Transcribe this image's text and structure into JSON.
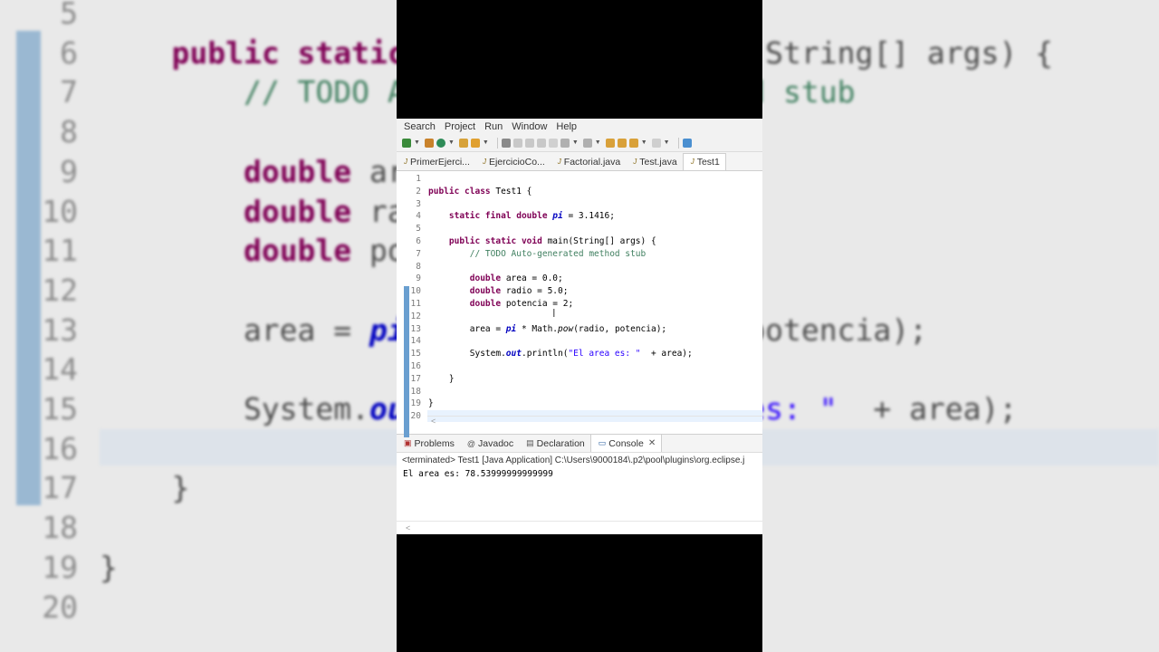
{
  "menu": [
    "Search",
    "Project",
    "Run",
    "Window",
    "Help"
  ],
  "toolbar_icons": [
    "new-icon",
    "debug-icon",
    "run-icon",
    "open-type-icon",
    "search-icon",
    "annotation-icon",
    "next-annotation-icon",
    "pin-icon",
    "back-icon",
    "forward-icon",
    "open-perspective-icon"
  ],
  "tabs": [
    "PrimerEjerci...",
    "EjercicioCo...",
    "Factorial.java",
    "Test.java",
    "Test1"
  ],
  "active_tab": "Test1",
  "code_lines": [
    {
      "n": "1",
      "html": ""
    },
    {
      "n": "2",
      "html": "<span class='kw'>public class</span> Test1 {"
    },
    {
      "n": "3",
      "html": ""
    },
    {
      "n": "4",
      "html": "    <span class='kw'>static final double</span> <span class='fld'>pi</span> = 3.1416;"
    },
    {
      "n": "5",
      "html": ""
    },
    {
      "n": "6",
      "html": "    <span class='kw'>public static void</span> main(String[] args) {"
    },
    {
      "n": "7",
      "html": "        <span class='cm'>// TODO Auto-generated method stub</span>"
    },
    {
      "n": "8",
      "html": ""
    },
    {
      "n": "9",
      "html": "        <span class='kw'>double</span> area = 0.0;"
    },
    {
      "n": "10",
      "html": "        <span class='kw'>double</span> radio = 5.0;"
    },
    {
      "n": "11",
      "html": "        <span class='kw'>double</span> potencia = 2;"
    },
    {
      "n": "12",
      "html": ""
    },
    {
      "n": "13",
      "html": "        area = <span class='fld'>pi</span> * Math.<span class='ital'>pow</span>(radio, potencia);"
    },
    {
      "n": "14",
      "html": ""
    },
    {
      "n": "15",
      "html": "        System.<span class='fld'>out</span>.println(<span class='st'>\"El area es: \"</span>  + area);"
    },
    {
      "n": "16",
      "html": ""
    },
    {
      "n": "17",
      "html": "    }"
    },
    {
      "n": "18",
      "html": ""
    },
    {
      "n": "19",
      "html": "}"
    },
    {
      "n": "20",
      "html": ""
    }
  ],
  "views": [
    "Problems",
    "Javadoc",
    "Declaration",
    "Console"
  ],
  "active_view": "Console",
  "console_header": "<terminated> Test1 [Java Application] C:\\Users\\9000184\\.p2\\pool\\plugins\\org.eclipse.j",
  "console_output": "El area es: 78.53999999999999",
  "background_lines": [
    {
      "n": "5",
      "html": ""
    },
    {
      "n": "6",
      "html": "    <span class='kw'>public static</span>                   (String[] args) {"
    },
    {
      "n": "7",
      "html": "        <span class='cm'>// TODO Auto-generated method stub</span>"
    },
    {
      "n": "8",
      "html": ""
    },
    {
      "n": "9",
      "html": "        <span class='kw'>double</span> area = 0.0;"
    },
    {
      "n": "10",
      "html": "        <span class='kw'>double</span> radio = 5.0;"
    },
    {
      "n": "11",
      "html": "        <span class='kw'>double</span> potencia = 2;"
    },
    {
      "n": "12",
      "html": ""
    },
    {
      "n": "13",
      "html": "        area = <span class='fld'>pi</span> * Math.<span class='ital'>pow</span>(radio, potencia);"
    },
    {
      "n": "14",
      "html": ""
    },
    {
      "n": "15",
      "html": "        System.<span class='fld'>out</span>.println(<span class='st'>\"El area es: \"</span>  + area);"
    },
    {
      "n": "16",
      "html": ""
    },
    {
      "n": "17",
      "html": "    }"
    },
    {
      "n": "18",
      "html": ""
    },
    {
      "n": "19",
      "html": "}"
    },
    {
      "n": "20",
      "html": ""
    }
  ]
}
